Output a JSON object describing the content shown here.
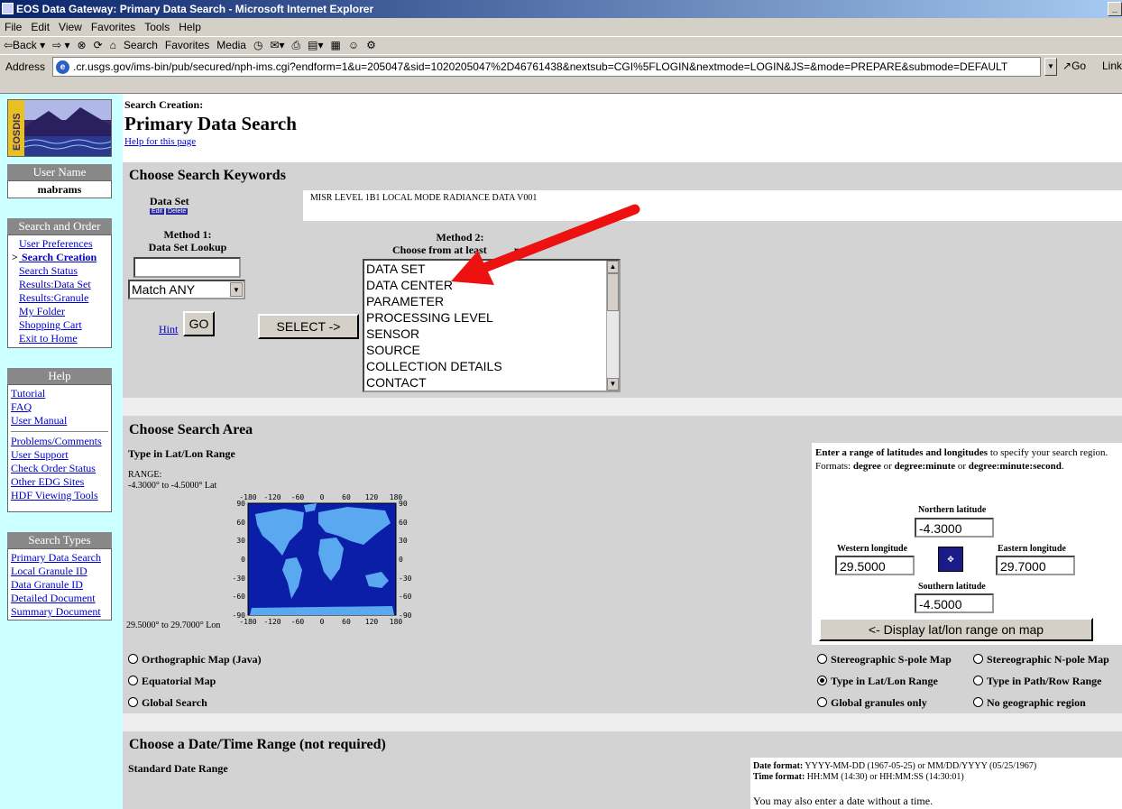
{
  "window": {
    "title": "EOS Data Gateway: Primary Data Search - Microsoft Internet Explorer",
    "ctrl_glyph": "_ □"
  },
  "menu": [
    "File",
    "Edit",
    "View",
    "Favorites",
    "Tools",
    "Help"
  ],
  "toolbar": [
    "⇦Back ▾",
    "⇨ ▾",
    "⊗",
    "⟳",
    "⌂",
    "Search",
    "Favorites",
    "Media",
    "◷",
    "✉▾",
    "⎙",
    "▤▾",
    "▦",
    "☺",
    "⚙"
  ],
  "address": {
    "label": "Address",
    "url": ".cr.usgs.gov/ims-bin/pub/secured/nph-ims.cgi?endform=1&u=205047&sid=1020205047%2D46761438&nextsub=CGI%5FLOGIN&nextmode=LOGIN&JS=&mode=PREPARE&submode=DEFAULT",
    "go": "Go",
    "links": "Link"
  },
  "logo_text": "EOSDIS",
  "sidebar": {
    "user_head": "User Name",
    "user_name": "mabrams",
    "search_order_head": "Search and Order",
    "search_order_items": [
      "User Preferences",
      "Search Creation",
      "Search Status",
      "Results:Data Set",
      "Results:Granule",
      "My Folder",
      "Shopping Cart",
      "Exit to Home"
    ],
    "help_head": "Help",
    "help_items_a": [
      "Tutorial",
      "FAQ",
      "User Manual"
    ],
    "help_items_b": [
      "Problems/Comments",
      "User Support",
      "Check Order Status",
      "Other EDG Sites",
      "HDF Viewing Tools"
    ],
    "types_head": "Search Types",
    "types_items": [
      "Primary Data Search",
      "Local Granule ID",
      "Data Granule ID",
      "Detailed Document",
      "Summary Document"
    ]
  },
  "header": {
    "creation": "Search Creation:",
    "title": "Primary Data Search",
    "help_link": "Help for this page"
  },
  "keywords": {
    "heading": "Choose Search Keywords",
    "data_set_label": "Data Set",
    "edit": "Edit",
    "delete": "Delete",
    "data_set_value": "MISR LEVEL 1B1 LOCAL MODE RADIANCE DATA V001",
    "method1_title": "Method 1:",
    "method1_sub": "Data Set Lookup",
    "lookup_value": "",
    "match_value": "Match ANY",
    "hint": "Hint",
    "go": "GO",
    "select_btn": "SELECT ->",
    "method2_title": "Method 2:",
    "method2_sub_a": "Choose from at least",
    "method2_sub_b": "rat",
    "options": [
      "DATA SET",
      "DATA CENTER",
      "PARAMETER",
      "PROCESSING LEVEL",
      "SENSOR",
      "SOURCE",
      "COLLECTION DETAILS",
      "CONTACT"
    ]
  },
  "area": {
    "heading": "Choose Search Area",
    "latlon_title": "Type in Lat/Lon Range",
    "range_label": "RANGE:",
    "lat_range": "-4.3000° to -4.5000° Lat",
    "lon_range": "29.5000° to 29.7000° Lon",
    "lon_ticks": [
      "-180",
      "-120",
      "-60",
      "0",
      "60",
      "120",
      "180"
    ],
    "lat_ticks": [
      "90",
      "60",
      "30",
      "0",
      "-30",
      "-60",
      "-90"
    ],
    "instr_bold_a": "Enter a range of latitudes and longitudes",
    "instr_a": " to specify your search region. Formats: ",
    "instr_bold_b": "degree",
    "instr_b": " or ",
    "instr_bold_c": "degree:minute",
    "instr_c": " or ",
    "instr_bold_d": "degree:minute:second",
    "instr_d": ".",
    "north_label": "Northern latitude",
    "north_value": "-4.3000",
    "west_label": "Western longitude",
    "west_value": "29.5000",
    "east_label": "Eastern longitude",
    "east_value": "29.7000",
    "south_label": "Southern latitude",
    "south_value": "-4.5000",
    "display_btn": "<- Display lat/lon range on map",
    "radios_left": [
      "Orthographic Map (Java)",
      "Equatorial Map",
      "Global Search"
    ],
    "radios_right": [
      [
        "Stereographic S-pole Map",
        "Stereographic N-pole Map"
      ],
      [
        "Type in Lat/Lon Range",
        "Type in Path/Row Range"
      ],
      [
        "Global granules only",
        "No geographic region"
      ]
    ],
    "selected": "Type in Lat/Lon Range"
  },
  "date": {
    "heading": "Choose a Date/Time Range (not required)",
    "standard": "Standard Date Range",
    "date_fmt_label": "Date format:",
    "date_fmt": " YYYY-MM-DD (1967-05-25) or MM/DD/YYYY (05/25/1967)",
    "time_fmt_label": "Time format:",
    "time_fmt": " HH:MM (14:30) or HH:MM:SS (14:30:01)",
    "note": "You may also enter a date without a time."
  },
  "colors": {
    "arrow": "#ee1111",
    "sidebar_bg": "#ccffff",
    "section_bg": "#d3d3d3",
    "map_ocean": "#0a1ea8",
    "map_land": "#5aa9f0"
  }
}
